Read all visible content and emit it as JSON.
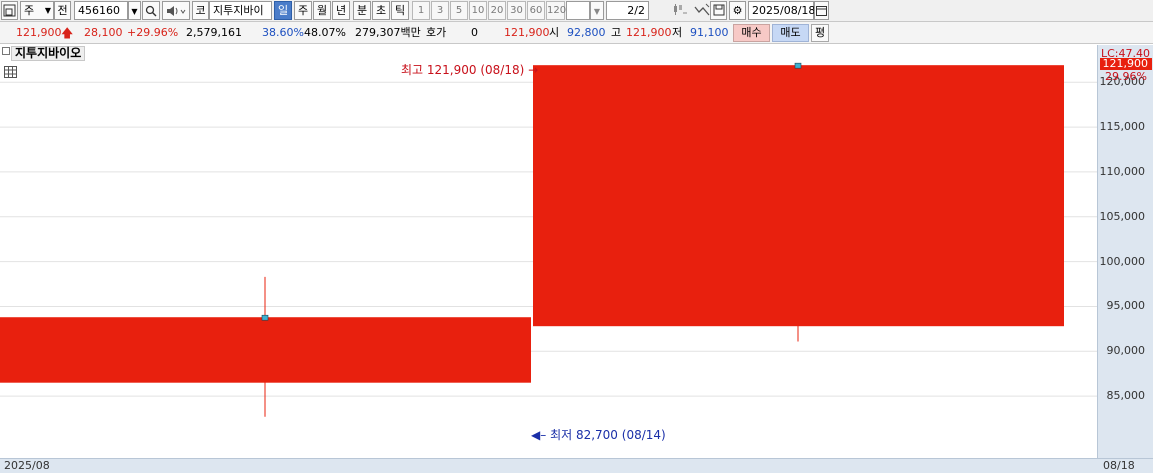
{
  "toolbar": {
    "market_select": "주",
    "prev_label": "전",
    "code": "456160",
    "search_icon": "search-icon",
    "type_label": "코",
    "stock_name": "지투지바이",
    "periods": [
      "일",
      "주",
      "월",
      "년",
      "분",
      "초",
      "틱"
    ],
    "active_period": "일",
    "intervals": [
      "1",
      "3",
      "5",
      "10",
      "20",
      "30",
      "60",
      "120"
    ],
    "page": "2",
    "page_total": "/2",
    "date": "2025/08/18"
  },
  "quote": {
    "price": "121,900",
    "change": "28,100",
    "change_pct": "+29.96%",
    "volume": "2,579,161",
    "ratio1": "38.60%",
    "ratio2": "48.07%",
    "amount": "279,307백만",
    "hoga_label": "호가",
    "hoga_value": "0",
    "hoga_price": "121,900",
    "open_label": "시",
    "open": "92,800",
    "high_label": "고",
    "high": "121,900",
    "low_label": "저",
    "low": "91,100",
    "buy_label": "매수",
    "sell_label": "매도",
    "avg_label": "평"
  },
  "legend": {
    "title": "지투지바이오"
  },
  "annotations": {
    "high_label": "최고 121,900 (08/18)",
    "low_label": "최저 82,700 (08/14)"
  },
  "y_axis": {
    "lc_label": "LC:47.40",
    "current_price": "121,900",
    "current_pct": "29.96%",
    "ticks": [
      "120,000",
      "115,000",
      "110,000",
      "105,000",
      "100,000",
      "95,000",
      "90,000",
      "85,000"
    ]
  },
  "x_axis": {
    "left_label": "2025/08",
    "right_label": "08/18"
  },
  "chart_data": {
    "type": "candlestick",
    "ylim": [
      80000,
      122700
    ],
    "candles": [
      {
        "date": "08/14",
        "open": 86500,
        "high": 98300,
        "low": 82700,
        "close": 93800
      },
      {
        "date": "08/18",
        "open": 92800,
        "high": 121900,
        "low": 91100,
        "close": 121900
      }
    ],
    "colors": {
      "up": "#e8200e",
      "tick_marker": "#3fb0d0",
      "annotation": "#c8101a",
      "annotation_low": "#1a2fa8"
    }
  }
}
